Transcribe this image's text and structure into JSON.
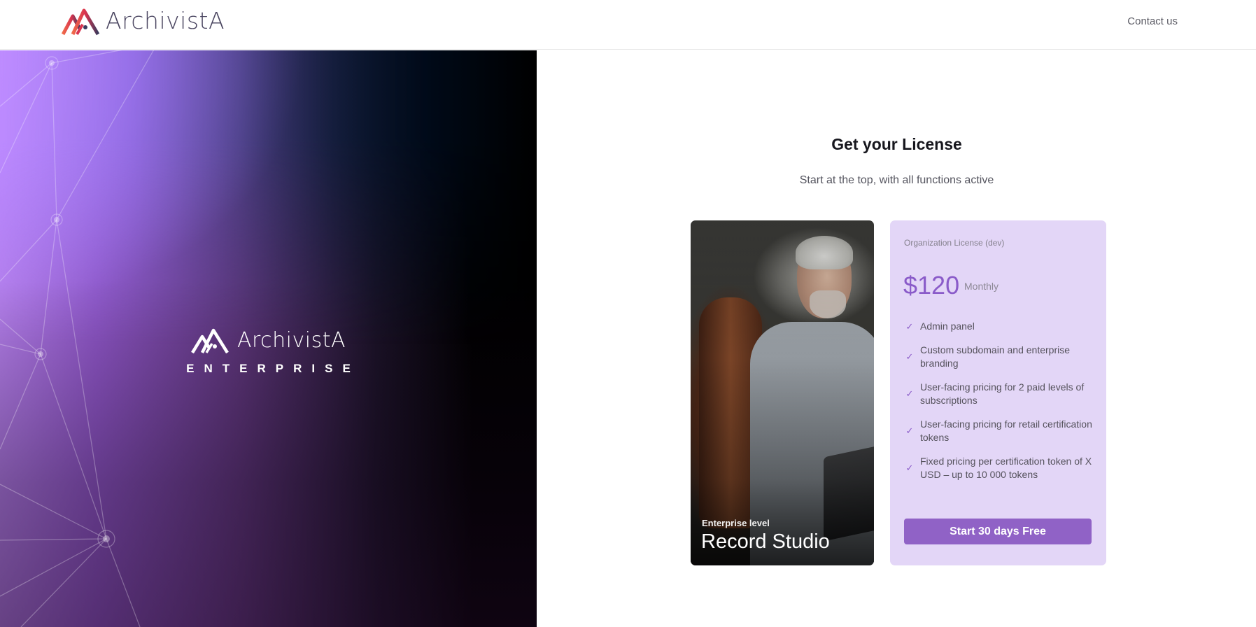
{
  "header": {
    "brand_name": "ArchivistA",
    "contact_label": "Contact us"
  },
  "hero": {
    "brand_name": "ArchivistA",
    "subtitle": "ENTERPRISE"
  },
  "main": {
    "title": "Get your License",
    "subtitle": "Start at the top, with all functions active"
  },
  "photo_card": {
    "level": "Enterprise level",
    "name": "Record Studio"
  },
  "pricing": {
    "plan_name": "Organization License (dev)",
    "price": "$120",
    "period": "Monthly",
    "features": [
      "Admin panel",
      "Custom subdomain and enterprise branding",
      "User-facing pricing for 2 paid levels of subscriptions",
      "User-facing pricing for retail certification tokens",
      "Fixed pricing per certification token of X USD – up to 10 000 tokens"
    ],
    "cta_label": "Start 30 days Free"
  },
  "colors": {
    "accent": "#9062c6",
    "price_text": "#8a5bc9",
    "card_bg": "#e3d6f7"
  }
}
